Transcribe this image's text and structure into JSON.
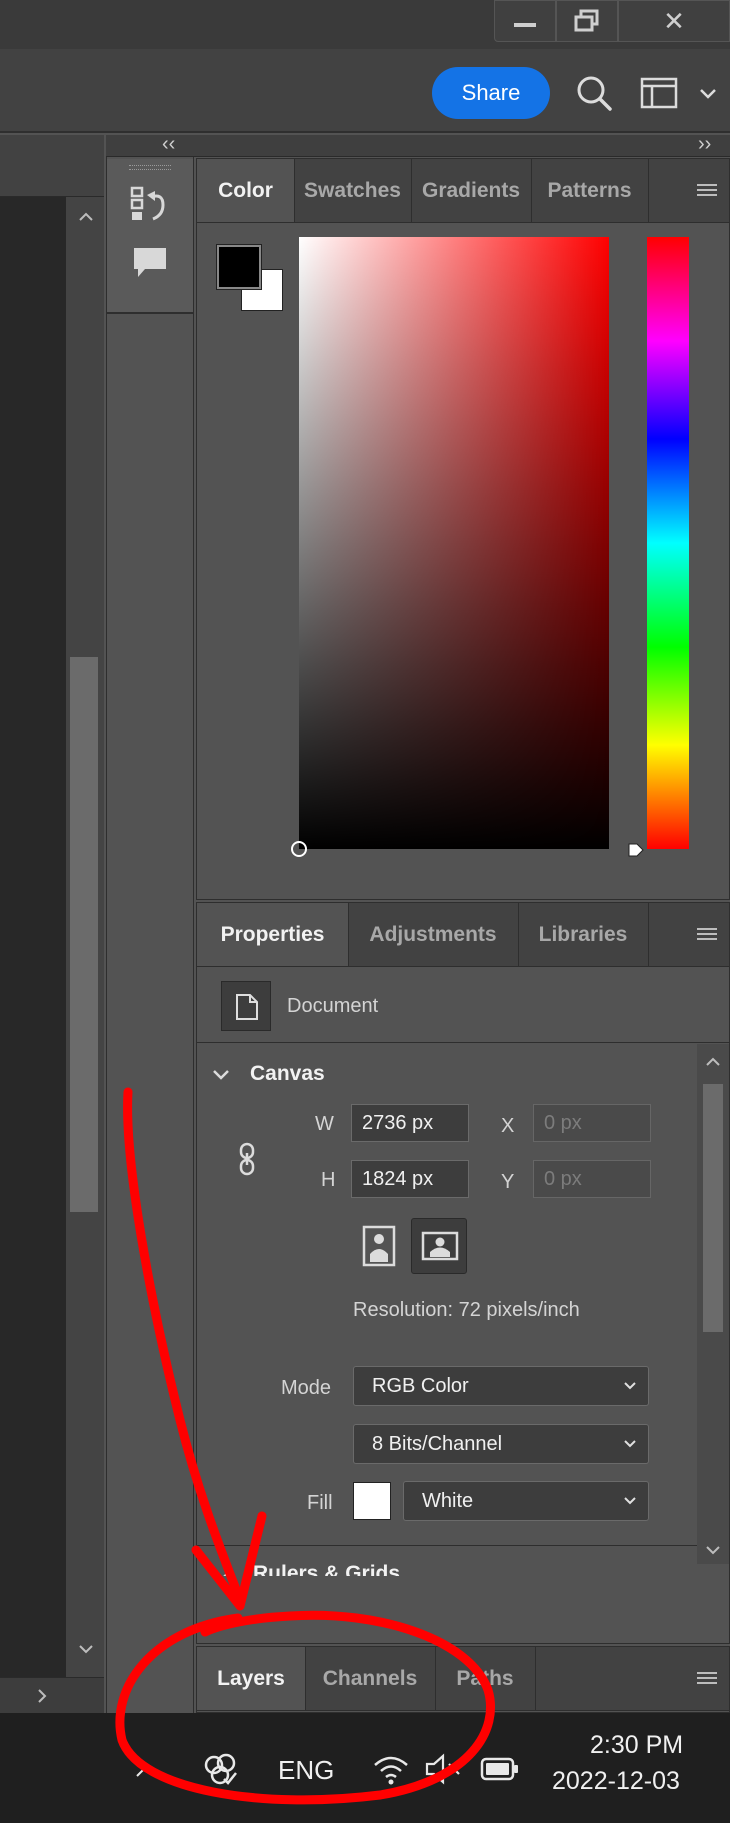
{
  "window": {
    "minimize_glyph": "—",
    "restore_glyph": "❐",
    "close_glyph": "✕"
  },
  "optionsbar": {
    "share_label": "Share",
    "icons": [
      "search-icon",
      "workspace-icon",
      "chevron-down-icon"
    ]
  },
  "collapse": {
    "left_arrows": "‹‹",
    "right_arrows": "››"
  },
  "color_panel": {
    "tabs": [
      "Color",
      "Swatches",
      "Gradients",
      "Patterns"
    ],
    "active_tab": "Color",
    "foreground": "#000000",
    "background": "#ffffff",
    "hue_color": "#ff0000"
  },
  "properties_panel": {
    "tabs": [
      "Properties",
      "Adjustments",
      "Libraries"
    ],
    "active_tab": "Properties",
    "type_label": "Document",
    "canvas_section": "Canvas",
    "w_label": "W",
    "w_value": "2736 px",
    "h_label": "H",
    "h_value": "1824 px",
    "x_label": "X",
    "x_placeholder": "0 px",
    "y_label": "Y",
    "y_placeholder": "0 px",
    "resolution": "Resolution: 72 pixels/inch",
    "mode_label": "Mode",
    "mode_value": "RGB Color",
    "bits_value": "8 Bits/Channel",
    "fill_label": "Fill",
    "fill_value": "White",
    "fill_color": "#ffffff",
    "next_section": "Rulers & Grids"
  },
  "layers_panel": {
    "tabs": [
      "Layers",
      "Channels",
      "Paths"
    ],
    "active_tab": "Layers"
  },
  "taskbar": {
    "language": "ENG",
    "time": "2:30 PM",
    "date": "2022-12-03"
  },
  "annotation": {
    "color": "#ff0000"
  }
}
